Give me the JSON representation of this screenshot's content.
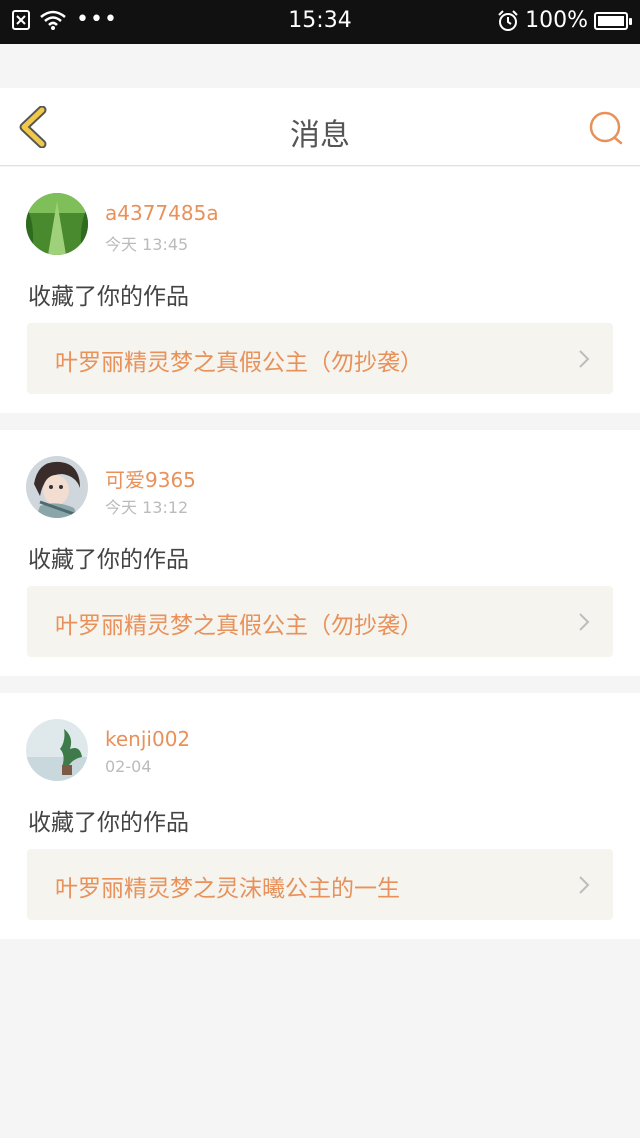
{
  "statusbar": {
    "time": "15:34",
    "battery": "100%",
    "dots": "•••",
    "icons": [
      "close-box-icon",
      "wifi-icon",
      "alarm-icon",
      "battery-icon"
    ]
  },
  "header": {
    "title": "消息",
    "back_icon": "chevron-left-icon",
    "search_icon": "search-icon"
  },
  "colors": {
    "accent": "#e8915a",
    "back": "#f0c94a",
    "card_bg": "#f5f4ee"
  },
  "messages": [
    {
      "user": "a4377485a",
      "time": "今天 13:45",
      "action": "收藏了你的作品",
      "work": "叶罗丽精灵梦之真假公主（勿抄袭）"
    },
    {
      "user": "可爱9365",
      "time": "今天 13:12",
      "action": "收藏了你的作品",
      "work": "叶罗丽精灵梦之真假公主（勿抄袭）"
    },
    {
      "user": "kenji002",
      "time": "02-04",
      "action": "收藏了你的作品",
      "work": "叶罗丽精灵梦之灵沫曦公主的一生"
    }
  ]
}
